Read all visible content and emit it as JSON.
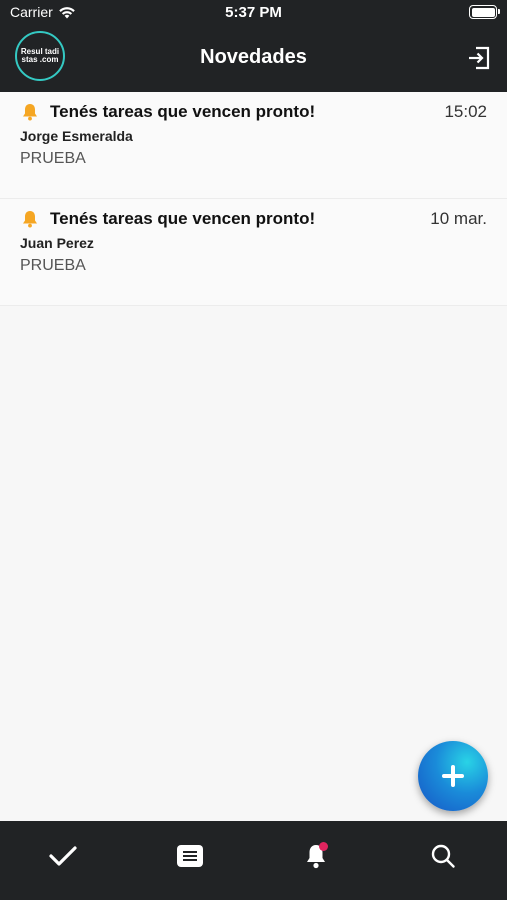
{
  "status_bar": {
    "carrier": "Carrier",
    "time": "5:37 PM"
  },
  "header": {
    "logo_text": "Resul tadistas .com",
    "title": "Novedades"
  },
  "notifications": [
    {
      "title": "Tenés tareas que vencen pronto!",
      "time": "15:02",
      "author": "Jorge Esmeralda",
      "body": "PRUEBA"
    },
    {
      "title": "Tenés tareas que vencen pronto!",
      "time": "10 mar.",
      "author": "Juan Perez",
      "body": "PRUEBA"
    }
  ],
  "tabbar": {
    "tabs": [
      "check-icon",
      "list-icon",
      "bell-icon",
      "search-icon"
    ],
    "active_tab": "bell-icon",
    "notification_dot_color": "#e0245e"
  },
  "colors": {
    "bar_background": "#212325",
    "accent": "#34c9c3",
    "bell": "#f5a623"
  }
}
